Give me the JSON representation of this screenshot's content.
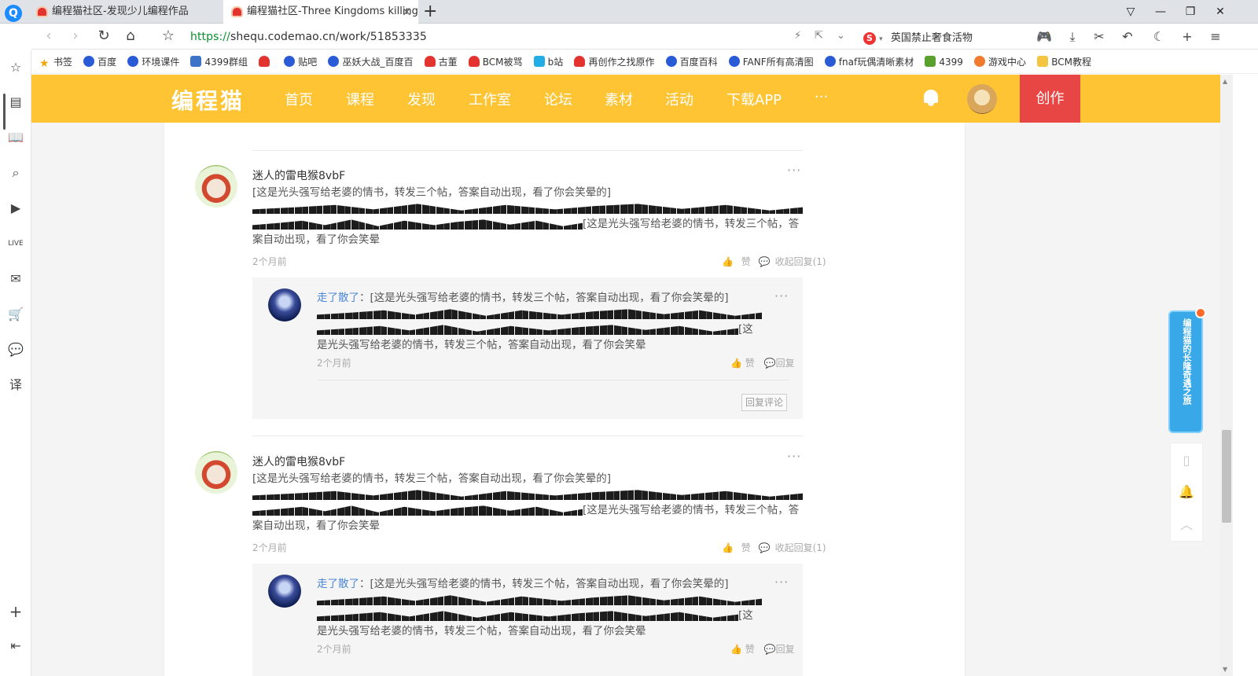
{
  "browser": {
    "tabs": [
      {
        "title": "编程猫社区-发现少儿编程作品"
      },
      {
        "title": "编程猫社区-Three Kingdoms killing"
      }
    ],
    "url_scheme": "https://",
    "url_rest": "shequ.codemao.cn/work/51853335",
    "search_text": "英国禁止奢食活物",
    "bookmarks": [
      "书签",
      "百度",
      "环境课件",
      "4399群组",
      "",
      "贴吧",
      "巫妖大战_百度百",
      "古董",
      "BCM被骂",
      "b站",
      "再创作之找原作",
      "百度百科",
      "FANF所有高清图",
      "fnaf玩偶清晰素材",
      "4399",
      "游戏中心",
      "BCM教程"
    ]
  },
  "site": {
    "logo": "编程猫",
    "nav": [
      "首页",
      "课程",
      "发现",
      "工作室",
      "论坛",
      "素材",
      "活动",
      "下载APP",
      "···"
    ],
    "create_label": "创作"
  },
  "comments": [
    {
      "user": "迷人的雷电猴8vbF",
      "text_before": "[这是光头强写给老婆的情书，转发三个帖，答案自动出现，看了你会笑晕的]",
      "text_after": "[这是光头强写给老婆的情书，转发三个帖，答案自动出现，看了你会笑晕",
      "time": "2个月前",
      "like": "赞",
      "collapse": "收起回复(1)",
      "reply": {
        "user": "走了散了",
        "sep": "：",
        "text_before": "[这是光头强写给老婆的情书，转发三个帖，答案自动出现，看了你会笑晕的]",
        "text_after": "[这是光头强写给老婆的情书，转发三个帖，答案自动出现，看了你会笑晕",
        "time": "2个月前",
        "like": "赞",
        "reply_label": "回复"
      },
      "reply_comment_label": "回复评论"
    },
    {
      "user": "迷人的雷电猴8vbF",
      "text_before": "[这是光头强写给老婆的情书，转发三个帖，答案自动出现，看了你会笑晕的]",
      "text_after": "[这是光头强写给老婆的情书，转发三个帖，答案自动出现，看了你会笑晕",
      "time": "2个月前",
      "like": "赞",
      "collapse": "收起回复(1)",
      "reply": {
        "user": "走了散了",
        "sep": "：",
        "text_before": "[这是光头强写给老婆的情书，转发三个帖，答案自动出现，看了你会笑晕的]",
        "text_after": "[这是光头强写给老婆的情书，转发三个帖，答案自动出现，看了你会笑晕",
        "time": "2个月前",
        "like": "赞",
        "reply_label": "回复"
      }
    }
  ],
  "promo": {
    "text": "编程猫的长隆奇遇之旅"
  },
  "colors": {
    "header": "#fec433",
    "create": "#e84545",
    "link": "#4a87d8"
  }
}
